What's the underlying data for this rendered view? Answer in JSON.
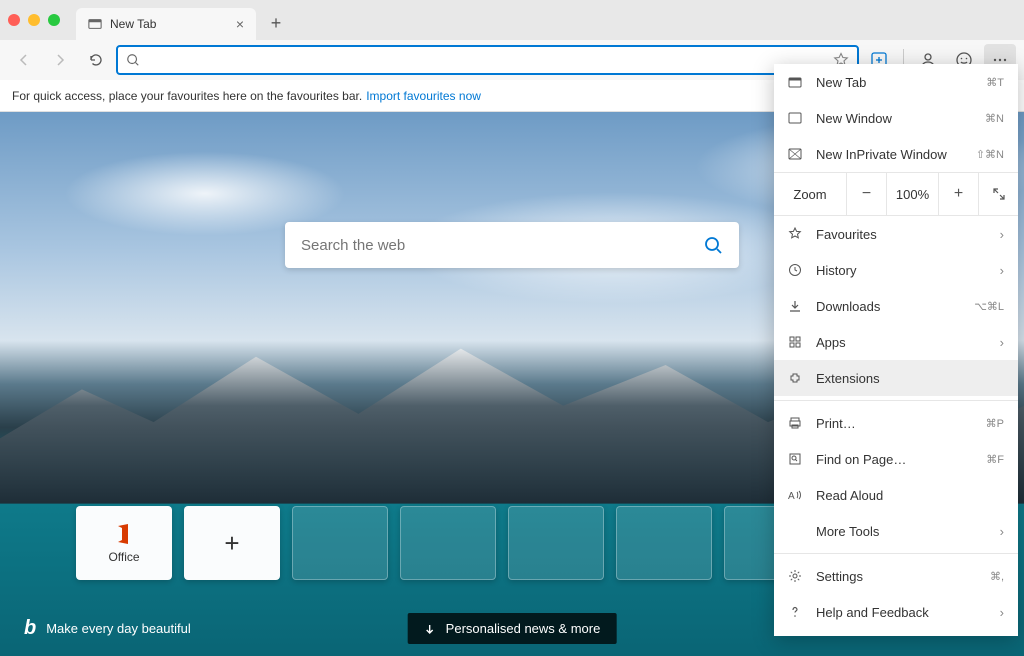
{
  "titlebar": {
    "tab_title": "New Tab"
  },
  "favbar": {
    "text": "For quick access, place your favourites here on the favourites bar.",
    "link": "Import favourites now"
  },
  "search": {
    "placeholder": "Search the web"
  },
  "tiles": [
    {
      "label": "Office",
      "icon": "office"
    },
    {
      "label": "",
      "icon": "add"
    }
  ],
  "footer": {
    "tagline": "Make every day beautiful",
    "pill": "Personalised news & more"
  },
  "menu": {
    "new_tab": "New Tab",
    "new_tab_short": "⌘T",
    "new_window": "New Window",
    "new_window_short": "⌘N",
    "new_inprivate": "New InPrivate Window",
    "new_inprivate_short": "⇧⌘N",
    "zoom_label": "Zoom",
    "zoom_value": "100%",
    "favourites": "Favourites",
    "history": "History",
    "downloads": "Downloads",
    "downloads_short": "⌥⌘L",
    "apps": "Apps",
    "extensions": "Extensions",
    "print": "Print…",
    "print_short": "⌘P",
    "find": "Find on Page…",
    "find_short": "⌘F",
    "read_aloud": "Read Aloud",
    "more_tools": "More Tools",
    "settings": "Settings",
    "settings_short": "⌘,",
    "help": "Help and Feedback"
  }
}
